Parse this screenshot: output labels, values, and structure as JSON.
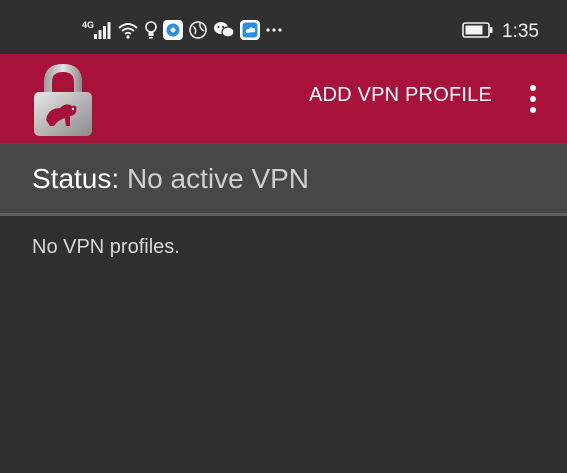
{
  "status_bar": {
    "network_label": "4G",
    "time": "1:35",
    "notification_icons": [
      "signal-icon",
      "wifi-icon",
      "bulb-icon",
      "app-blue-icon",
      "browser-icon",
      "wechat-icon",
      "cloud-app-icon",
      "more-notifications-icon"
    ]
  },
  "app_bar": {
    "logo_icon": "padlock-logo-icon",
    "action_label": "ADD VPN PROFILE",
    "overflow_icon": "more-vert-icon",
    "background_color": "#a8123a"
  },
  "status": {
    "label": "Status:",
    "value": "No active VPN"
  },
  "content": {
    "empty_message": "No VPN profiles."
  }
}
